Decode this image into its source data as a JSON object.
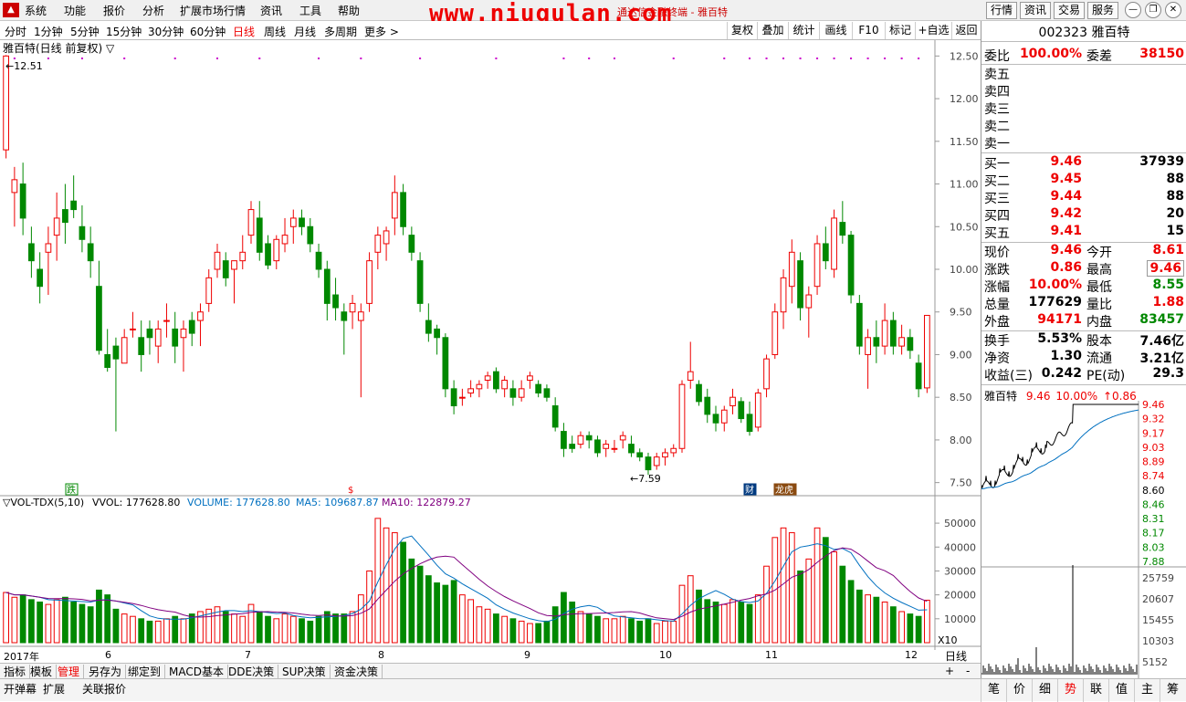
{
  "menubar": {
    "items": [
      "系统",
      "功能",
      "报价",
      "分析",
      "扩展市场行情",
      "资讯",
      "工具",
      "帮助"
    ],
    "watermark": "www.niugulan.com",
    "window_title": "通达信金融终端 - 雅百特",
    "right_buttons": [
      "行情",
      "资讯",
      "交易",
      "服务"
    ]
  },
  "period_bar": {
    "items": [
      "分时",
      "1分钟",
      "5分钟",
      "15分钟",
      "30分钟",
      "60分钟",
      "日线",
      "周线",
      "月线",
      "多周期",
      "更多 >"
    ],
    "active": "日线",
    "tools": [
      "复权",
      "叠加",
      "统计",
      "画线",
      "F10",
      "标记",
      "+自选",
      "返回"
    ]
  },
  "main_chart": {
    "title": "雅百特(日线 前复权) ▽",
    "high_label": "12.51",
    "low_label": "7.59",
    "y_ticks": [
      "12.50",
      "12.00",
      "11.50",
      "11.00",
      "10.50",
      "10.00",
      "9.50",
      "9.00",
      "8.50",
      "8.00",
      "7.50"
    ],
    "markers": [
      {
        "text": "跌",
        "color": "#080"
      },
      {
        "text": "$",
        "color": "#e00"
      },
      {
        "text": "财",
        "color": "#fff"
      },
      {
        "text": "龙虎",
        "color": "#fff"
      }
    ]
  },
  "volume_chart": {
    "indicator": "▽VOL-TDX(5,10)",
    "vvol": "VVOL: 177628.80",
    "volume": "VOLUME: 177628.80",
    "ma5": "MA5: 109687.87",
    "ma10": "MA10: 122879.27",
    "y_ticks": [
      "50000",
      "40000",
      "30000",
      "20000",
      "10000"
    ],
    "unit": "X10"
  },
  "time_axis": {
    "labels": [
      "2017年",
      "6",
      "7",
      "8",
      "9",
      "10",
      "11",
      "12"
    ],
    "right_label": "日线"
  },
  "bottom_tabs1": [
    "指标",
    "模板",
    "管理",
    "另存为",
    "绑定到",
    "MACD基本",
    "DDE决策",
    "SUP决策",
    "资金决策"
  ],
  "bottom_tabs2": [
    "开弹幕",
    "扩展",
    "关联报价"
  ],
  "right_tabs": [
    "笔",
    "价",
    "细",
    "势",
    "联",
    "值",
    "主",
    "筹"
  ],
  "quote": {
    "code": "002323",
    "name": "雅百特",
    "wei_bi_label": "委比",
    "wei_bi": "100.00%",
    "wei_cha_label": "委差",
    "wei_cha": "38150",
    "sell": [
      "卖五",
      "卖四",
      "卖三",
      "卖二",
      "卖一"
    ],
    "buy": [
      {
        "label": "买一",
        "price": "9.46",
        "vol": "37939"
      },
      {
        "label": "买二",
        "price": "9.45",
        "vol": "88"
      },
      {
        "label": "买三",
        "price": "9.44",
        "vol": "88"
      },
      {
        "label": "买四",
        "price": "9.42",
        "vol": "20"
      },
      {
        "label": "买五",
        "price": "9.41",
        "vol": "15"
      }
    ],
    "stats": [
      {
        "l1": "现价",
        "v1": "9.46",
        "c1": "red",
        "l2": "今开",
        "v2": "8.61",
        "c2": "red"
      },
      {
        "l1": "涨跌",
        "v1": "0.86",
        "c1": "red",
        "l2": "最高",
        "v2": "9.46",
        "c2": "red"
      },
      {
        "l1": "涨幅",
        "v1": "10.00%",
        "c1": "red",
        "l2": "最低",
        "v2": "8.55",
        "c2": "green"
      },
      {
        "l1": "总量",
        "v1": "177629",
        "c1": "blk",
        "l2": "量比",
        "v2": "1.88",
        "c2": "red"
      },
      {
        "l1": "外盘",
        "v1": "94171",
        "c1": "red",
        "l2": "内盘",
        "v2": "83457",
        "c2": "green"
      }
    ],
    "stats2": [
      {
        "l1": "换手",
        "v1": "5.53%",
        "l2": "股本",
        "v2": "7.46亿"
      },
      {
        "l1": "净资",
        "v1": "1.30",
        "l2": "流通",
        "v2": "3.21亿"
      },
      {
        "l1": "收益(三)",
        "v1": "0.242",
        "l2": "PE(动)",
        "v2": "29.3"
      }
    ]
  },
  "mini_chart": {
    "name": "雅百特",
    "price": "9.46",
    "pct": "10.00%",
    "change": "↑0.86",
    "price_ticks": [
      "9.46",
      "9.32",
      "9.17",
      "9.03",
      "8.89",
      "8.74",
      "8.60",
      "8.46",
      "8.31",
      "8.17",
      "8.03",
      "7.88"
    ],
    "vol_ticks": [
      "25759",
      "20607",
      "15455",
      "10303",
      "5152"
    ]
  },
  "chart_data": {
    "type": "candlestick",
    "ylim": [
      7.4,
      12.6
    ],
    "candles": [
      [
        11.4,
        12.51,
        11.3,
        12.5
      ],
      [
        10.9,
        11.2,
        10.5,
        11.05
      ],
      [
        11.0,
        11.25,
        10.4,
        10.6
      ],
      [
        10.3,
        10.5,
        9.9,
        10.1
      ],
      [
        10.0,
        10.2,
        9.6,
        9.8
      ],
      [
        10.2,
        10.5,
        9.7,
        10.3
      ],
      [
        10.4,
        10.9,
        10.1,
        10.6
      ],
      [
        10.7,
        11.0,
        10.3,
        10.55
      ],
      [
        10.8,
        11.1,
        10.6,
        10.7
      ],
      [
        10.5,
        10.75,
        10.2,
        10.35
      ],
      [
        10.3,
        10.5,
        9.9,
        10.1
      ],
      [
        9.8,
        10.1,
        9.0,
        9.05
      ],
      [
        9.0,
        9.3,
        8.8,
        8.85
      ],
      [
        9.1,
        9.2,
        8.1,
        8.95
      ],
      [
        8.9,
        9.3,
        8.9,
        9.2
      ],
      [
        9.3,
        9.5,
        9.2,
        9.3
      ],
      [
        9.2,
        9.4,
        8.8,
        9.0
      ],
      [
        9.3,
        9.4,
        9.0,
        9.2
      ],
      [
        9.1,
        9.4,
        8.9,
        9.3
      ],
      [
        9.4,
        9.6,
        9.2,
        9.4
      ],
      [
        9.3,
        9.5,
        8.9,
        9.1
      ],
      [
        9.2,
        9.4,
        8.8,
        9.3
      ],
      [
        9.4,
        9.5,
        9.1,
        9.25
      ],
      [
        9.4,
        9.6,
        9.1,
        9.5
      ],
      [
        9.6,
        10.0,
        9.5,
        9.9
      ],
      [
        10.0,
        10.3,
        9.9,
        10.2
      ],
      [
        10.1,
        10.2,
        9.8,
        9.9
      ],
      [
        10.0,
        10.1,
        9.6,
        10.1
      ],
      [
        10.1,
        10.4,
        10.0,
        10.2
      ],
      [
        10.4,
        10.8,
        10.3,
        10.7
      ],
      [
        10.6,
        10.8,
        10.1,
        10.2
      ],
      [
        10.3,
        10.4,
        10.0,
        10.05
      ],
      [
        10.1,
        10.4,
        10.0,
        10.35
      ],
      [
        10.3,
        10.6,
        10.2,
        10.4
      ],
      [
        10.5,
        10.7,
        10.3,
        10.6
      ],
      [
        10.6,
        10.7,
        10.4,
        10.5
      ],
      [
        10.5,
        10.6,
        10.2,
        10.3
      ],
      [
        10.2,
        10.3,
        9.9,
        10.0
      ],
      [
        10.0,
        10.1,
        9.4,
        9.6
      ],
      [
        9.7,
        9.9,
        9.4,
        9.55
      ],
      [
        9.5,
        9.6,
        9.0,
        9.4
      ],
      [
        9.5,
        9.7,
        9.3,
        9.6
      ],
      [
        9.4,
        9.6,
        8.5,
        9.5
      ],
      [
        9.6,
        10.2,
        9.5,
        10.1
      ],
      [
        10.2,
        10.5,
        10.0,
        10.4
      ],
      [
        10.3,
        10.5,
        10.1,
        10.45
      ],
      [
        10.6,
        11.1,
        10.4,
        10.9
      ],
      [
        10.9,
        11.0,
        10.4,
        10.5
      ],
      [
        10.4,
        10.5,
        10.1,
        10.2
      ],
      [
        10.1,
        10.2,
        9.5,
        9.6
      ],
      [
        9.4,
        9.6,
        9.15,
        9.25
      ],
      [
        9.3,
        9.35,
        9.0,
        9.2
      ],
      [
        9.2,
        9.25,
        8.5,
        8.6
      ],
      [
        8.6,
        8.7,
        8.3,
        8.4
      ],
      [
        8.5,
        8.6,
        8.4,
        8.5
      ],
      [
        8.55,
        8.7,
        8.5,
        8.6
      ],
      [
        8.6,
        8.7,
        8.5,
        8.65
      ],
      [
        8.7,
        8.8,
        8.6,
        8.75
      ],
      [
        8.8,
        8.85,
        8.55,
        8.6
      ],
      [
        8.6,
        8.75,
        8.5,
        8.7
      ],
      [
        8.6,
        8.7,
        8.4,
        8.5
      ],
      [
        8.5,
        8.7,
        8.45,
        8.6
      ],
      [
        8.7,
        8.8,
        8.6,
        8.75
      ],
      [
        8.65,
        8.7,
        8.5,
        8.55
      ],
      [
        8.6,
        8.65,
        8.45,
        8.5
      ],
      [
        8.4,
        8.5,
        8.1,
        8.15
      ],
      [
        8.1,
        8.2,
        7.8,
        7.9
      ],
      [
        7.95,
        8.05,
        7.85,
        7.9
      ],
      [
        7.95,
        8.1,
        7.9,
        8.05
      ],
      [
        8.05,
        8.1,
        7.9,
        8.0
      ],
      [
        8.0,
        8.05,
        7.8,
        7.85
      ],
      [
        7.9,
        8.0,
        7.8,
        7.95
      ],
      [
        7.9,
        8.0,
        7.85,
        7.9
      ],
      [
        8.0,
        8.1,
        7.9,
        8.05
      ],
      [
        7.95,
        8.05,
        7.8,
        7.85
      ],
      [
        7.85,
        7.9,
        7.75,
        7.8
      ],
      [
        7.8,
        7.85,
        7.59,
        7.65
      ],
      [
        7.7,
        7.85,
        7.65,
        7.8
      ],
      [
        7.8,
        7.9,
        7.7,
        7.85
      ],
      [
        7.85,
        7.95,
        7.8,
        7.9
      ],
      [
        7.9,
        8.7,
        7.85,
        8.65
      ],
      [
        8.7,
        9.15,
        8.6,
        8.8
      ],
      [
        8.65,
        8.7,
        8.4,
        8.45
      ],
      [
        8.5,
        8.6,
        8.2,
        8.3
      ],
      [
        8.3,
        8.4,
        8.1,
        8.2
      ],
      [
        8.2,
        8.4,
        8.1,
        8.35
      ],
      [
        8.4,
        8.6,
        8.3,
        8.5
      ],
      [
        8.45,
        8.5,
        8.2,
        8.25
      ],
      [
        8.3,
        8.45,
        8.05,
        8.1
      ],
      [
        8.15,
        8.6,
        8.1,
        8.55
      ],
      [
        8.6,
        9.0,
        8.5,
        8.95
      ],
      [
        9.0,
        9.6,
        8.95,
        9.5
      ],
      [
        9.5,
        10.0,
        9.3,
        9.9
      ],
      [
        9.8,
        10.35,
        9.6,
        10.2
      ],
      [
        10.1,
        10.2,
        9.4,
        9.55
      ],
      [
        9.55,
        9.8,
        9.2,
        9.7
      ],
      [
        9.8,
        10.4,
        9.7,
        10.3
      ],
      [
        10.3,
        10.5,
        10.0,
        10.1
      ],
      [
        10.0,
        10.7,
        9.9,
        10.6
      ],
      [
        10.55,
        10.8,
        10.3,
        10.4
      ],
      [
        10.4,
        10.45,
        9.6,
        9.7
      ],
      [
        9.6,
        9.7,
        9.0,
        9.1
      ],
      [
        9.0,
        9.3,
        8.6,
        9.2
      ],
      [
        9.2,
        9.4,
        8.9,
        9.1
      ],
      [
        9.1,
        9.6,
        9.0,
        9.4
      ],
      [
        9.4,
        9.5,
        9.0,
        9.1
      ],
      [
        9.1,
        9.35,
        9.0,
        9.2
      ],
      [
        9.2,
        9.3,
        8.95,
        9.05
      ],
      [
        8.9,
        9.0,
        8.5,
        8.6
      ],
      [
        8.61,
        9.46,
        8.55,
        9.46
      ]
    ],
    "volume": [
      21000,
      19000,
      20000,
      18000,
      17000,
      16000,
      18000,
      19000,
      17000,
      16000,
      15000,
      22000,
      20000,
      14000,
      12000,
      11000,
      10000,
      9000,
      9000,
      10000,
      11000,
      10000,
      12000,
      13000,
      14000,
      15000,
      13000,
      12000,
      11000,
      16000,
      13000,
      11000,
      10000,
      12000,
      11000,
      10000,
      9000,
      11000,
      13000,
      12000,
      12000,
      13000,
      20000,
      30000,
      52000,
      48000,
      46000,
      42000,
      35000,
      32000,
      28000,
      25000,
      24000,
      26000,
      20000,
      18000,
      15000,
      14000,
      12000,
      11000,
      10000,
      9000,
      8000,
      8000,
      9000,
      15000,
      21000,
      17000,
      13000,
      12000,
      11000,
      10000,
      10000,
      11000,
      10000,
      9000,
      10000,
      8000,
      9000,
      9000,
      24000,
      28000,
      22000,
      18000,
      17000,
      16000,
      18000,
      17000,
      16000,
      20000,
      32000,
      44000,
      48000,
      46000,
      30000,
      35000,
      48000,
      44000,
      38000,
      32000,
      26000,
      22000,
      20000,
      19000,
      17000,
      15000,
      13000,
      12000,
      11000,
      17763
    ]
  }
}
